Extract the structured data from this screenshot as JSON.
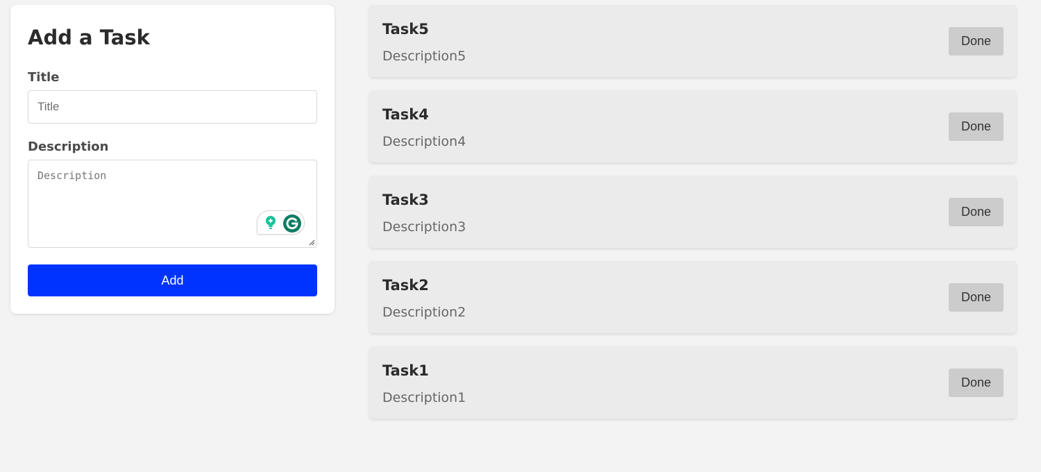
{
  "form": {
    "heading": "Add a Task",
    "title_label": "Title",
    "title_placeholder": "Title",
    "title_value": "",
    "description_label": "Description",
    "description_placeholder": "Description",
    "description_value": "",
    "add_label": "Add"
  },
  "tasks": [
    {
      "title": "Task5",
      "description": "Description5",
      "done_label": "Done"
    },
    {
      "title": "Task4",
      "description": "Description4",
      "done_label": "Done"
    },
    {
      "title": "Task3",
      "description": "Description3",
      "done_label": "Done"
    },
    {
      "title": "Task2",
      "description": "Description2",
      "done_label": "Done"
    },
    {
      "title": "Task1",
      "description": "Description1",
      "done_label": "Done"
    }
  ],
  "writing_assistant": {
    "icons": [
      "lightbulb-icon",
      "grammarly-icon"
    ]
  },
  "colors": {
    "background": "#f3f3f3",
    "card": "#ffffff",
    "task_card": "#ebebeb",
    "primary_button": "#0033ff",
    "done_button": "#cccccc",
    "assistant_green": "#15c39a",
    "assistant_dark_green": "#0b7d63"
  }
}
